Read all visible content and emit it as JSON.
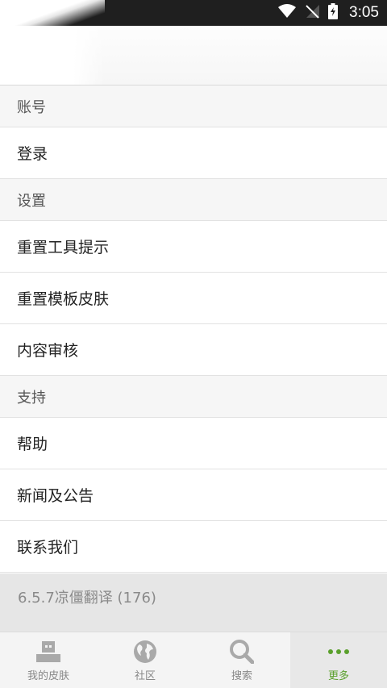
{
  "status_bar": {
    "time": "3:05"
  },
  "menu": {
    "sections": [
      {
        "header": "账号",
        "items": [
          "登录"
        ]
      },
      {
        "header": "设置",
        "items": [
          "重置工具提示",
          "重置模板皮肤",
          "内容审核"
        ]
      },
      {
        "header": "支持",
        "items": [
          "帮助",
          "新闻及公告",
          "联系我们"
        ]
      }
    ]
  },
  "version": "6.5.7凉僵翻译 (176)",
  "bottom_nav": {
    "tabs": [
      {
        "label": "我的皮肤",
        "icon": "skin-icon"
      },
      {
        "label": "社区",
        "icon": "globe-icon"
      },
      {
        "label": "搜索",
        "icon": "search-icon"
      },
      {
        "label": "更多",
        "icon": "more-dots-icon"
      }
    ],
    "active_index": 3
  },
  "colors": {
    "accent": "#5aa02c",
    "status_bar": "#1f1f1f",
    "section_header_bg": "#f6f6f6",
    "version_bg": "#e6e6e6",
    "inactive_icon": "#a9a9a9"
  }
}
